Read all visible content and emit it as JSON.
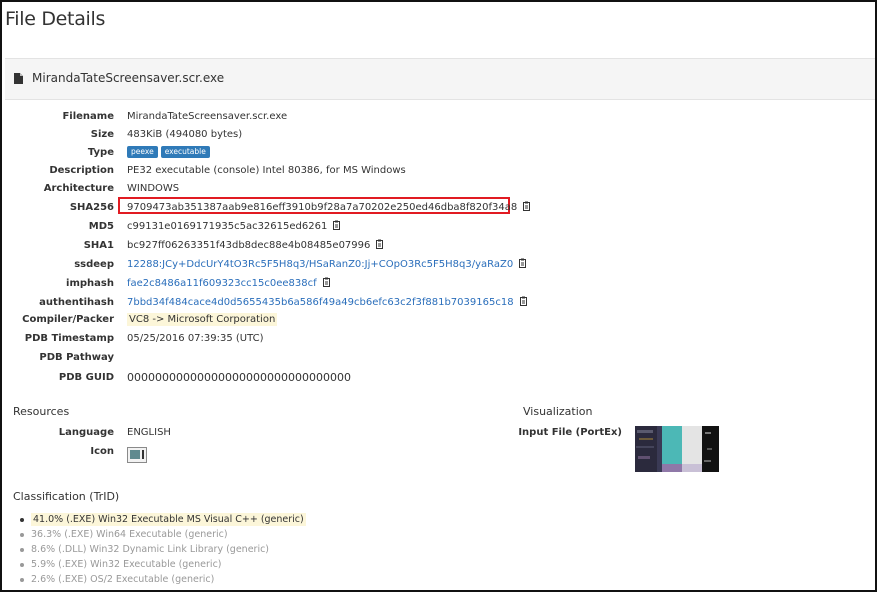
{
  "page": {
    "title": "File Details"
  },
  "file": {
    "name": "MirandaTateScreensaver.scr.exe"
  },
  "details": {
    "filename": {
      "label": "Filename",
      "value": "MirandaTateScreensaver.scr.exe"
    },
    "size": {
      "label": "Size",
      "value": "483KiB (494080 bytes)"
    },
    "type": {
      "label": "Type",
      "badges": [
        "peexe",
        "executable"
      ]
    },
    "description": {
      "label": "Description",
      "value": "PE32 executable (console) Intel 80386, for MS Windows"
    },
    "architecture": {
      "label": "Architecture",
      "value": "WINDOWS"
    },
    "sha256": {
      "label": "SHA256",
      "value": "9709473ab351387aab9e816eff3910b9f28a7a70202e250ed46dba8f820f34a8"
    },
    "md5": {
      "label": "MD5",
      "value": "c99131e0169171935c5ac32615ed6261"
    },
    "sha1": {
      "label": "SHA1",
      "value": "bc927ff06263351f43db8dec88e4b08485e07996"
    },
    "ssdeep": {
      "label": "ssdeep",
      "value": "12288:JCy+DdcUrY4tO3Rc5F5H8q3/HSaRanZ0:Jj+COpO3Rc5F5H8q3/yaRaZ0"
    },
    "imphash": {
      "label": "imphash",
      "value": "fae2c8486a11f609323cc15c0ee838cf"
    },
    "authentihash": {
      "label": "authentihash",
      "value": "7bbd34f484cace4d0d5655435b6a586f49a49cb6efc63c2f3f881b7039165c18"
    },
    "compiler": {
      "label": "Compiler/Packer",
      "value": "VC8 -> Microsoft Corporation"
    },
    "pdb_timestamp": {
      "label": "PDB Timestamp",
      "value": "05/25/2016 07:39:35 (UTC)"
    },
    "pdb_pathway": {
      "label": "PDB Pathway",
      "value": ""
    },
    "pdb_guid": {
      "label": "PDB GUID",
      "value": "00000000000000000000000000000000"
    }
  },
  "resources": {
    "title": "Resources",
    "language": {
      "label": "Language",
      "value": "ENGLISH"
    },
    "icon": {
      "label": "Icon"
    }
  },
  "visualization": {
    "title": "Visualization",
    "input_file": {
      "label": "Input File (PortEx)"
    }
  },
  "classification": {
    "title": "Classification (TrID)",
    "items": [
      "41.0% (.EXE) Win32 Executable MS Visual C++ (generic)",
      "36.3% (.EXE) Win64 Executable (generic)",
      "8.6% (.DLL) Win32 Dynamic Link Library (generic)",
      "5.9% (.EXE) Win32 Executable (generic)",
      "2.6% (.EXE) OS/2 Executable (generic)"
    ]
  },
  "colors": {
    "link": "#2a6ebb",
    "badge": "#2f7ab8",
    "highlight": "#fcf6d9",
    "annotation_box": "#e11b22"
  }
}
